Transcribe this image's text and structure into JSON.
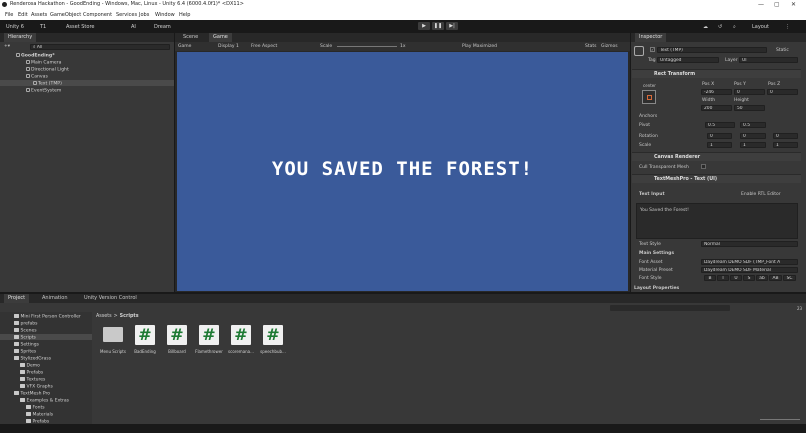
{
  "window": {
    "title": "Renderosa Hackathon - GoodEnding - Windows, Mac, Linux - Unity 6.4 (6000.4.0f1)* <DX11>"
  },
  "menu": [
    "File",
    "Edit",
    "Assets",
    "GameObject",
    "Component",
    "Services",
    "Jobs",
    "Window",
    "Help"
  ],
  "toolbar": {
    "account": "Unity 6",
    "t1": "T1",
    "asset_store": "Asset Store",
    "ai": "AI",
    "dream": "Dream",
    "layout": "Layout"
  },
  "hierarchy": {
    "tab": "Hierarchy",
    "search_placeholder": "All",
    "items": [
      "GoodEnding*",
      "Main Camera",
      "Directional Light",
      "Canvas",
      "Text (TMP)",
      "EventSystem"
    ]
  },
  "scene_view": {
    "tabs": [
      "Scene",
      "Game"
    ],
    "game_dropdown": "Game",
    "display": "Display 1",
    "aspect": "Free Aspect",
    "scale_label": "Scale",
    "scale_value": "1x",
    "play_mode": "Play Maximized",
    "stats": "Stats",
    "gizmos": "Gizmos",
    "game_text": "YOU SAVED THE FOREST!",
    "background": "#3a5a9a"
  },
  "inspector": {
    "tab": "Inspector",
    "object_name": "Text (TMP)",
    "static": "Static",
    "tag_label": "Tag",
    "tag_value": "Untagged",
    "layer_label": "Layer",
    "layer_value": "UI",
    "rect_transform": {
      "header": "Rect Transform",
      "anchor_label": "center",
      "pos_x_label": "Pos X",
      "pos_y_label": "Pos Y",
      "pos_z_label": "Pos Z",
      "pos_x": "-246",
      "pos_y": "0",
      "pos_z": "0",
      "width_label": "Width",
      "height_label": "Height",
      "width": "200",
      "height": "50",
      "anchors": "Anchors",
      "pivot_label": "Pivot",
      "pivot_x": "0.5",
      "pivot_y": "0.5",
      "rotation_label": "Rotation",
      "rot_x": "0",
      "rot_y": "0",
      "rot_z": "0",
      "scale_label": "Scale",
      "scale_x": "1",
      "scale_y": "1",
      "scale_z": "1"
    },
    "canvas_renderer": {
      "header": "Canvas Renderer",
      "cull_label": "Cull Transparent Mesh"
    },
    "tmp": {
      "header": "TextMeshPro - Text (UI)",
      "text_input_label": "Text Input",
      "rtl_label": "Enable RTL Editor",
      "text_value": "You Saved the Forest!",
      "text_style_label": "Text Style",
      "text_style_value": "Normal",
      "main_settings": "Main Settings",
      "font_asset_label": "Font Asset",
      "font_asset_value": "Daydream DEMO SDF (TMP_Font A",
      "material_label": "Material Preset",
      "material_value": "Daydream DEMO SDF Material",
      "font_style_label": "Font Style",
      "font_style_buttons": [
        "B",
        "I",
        "U",
        "S",
        "ab",
        "AB",
        "SC"
      ],
      "layout_properties": "Layout Properties"
    }
  },
  "project": {
    "tabs": [
      "Project",
      "Animation",
      "Unity Version Control"
    ],
    "tree": [
      "Mini First Person Controller",
      "prefabs",
      "Scenes",
      "Scripts",
      "Settings",
      "Sprites",
      "StylizedGrass",
      "Demo",
      "Prefabs",
      "Textures",
      "VFX Graphs",
      "TextMesh Pro",
      "Examples & Extras",
      "Fonts",
      "Materials",
      "Prefabs",
      "Resources"
    ],
    "breadcrumb": [
      "Assets",
      "Scripts"
    ],
    "assets": [
      "Menu Scripts",
      "BadEnding",
      "Billboard",
      "Flamethrower",
      "scoremana...",
      "speechbub..."
    ],
    "asset_count": "23"
  }
}
